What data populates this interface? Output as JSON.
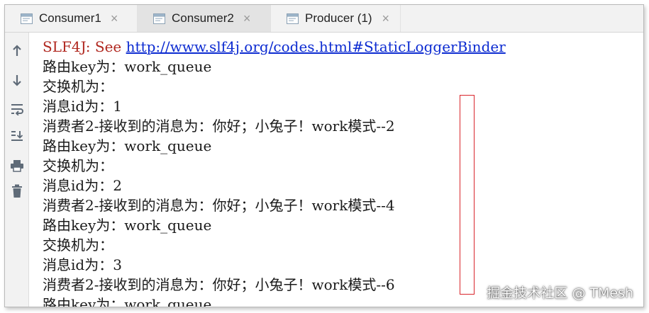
{
  "tabs": [
    {
      "label": "Consumer1",
      "close": "×",
      "active": false
    },
    {
      "label": "Consumer2",
      "close": "×",
      "active": true
    },
    {
      "label": "Producer (1)",
      "close": "×",
      "active": false
    }
  ],
  "sidebar": {
    "icons": [
      "arrow-up-icon",
      "arrow-down-icon",
      "soft-wrap-icon",
      "scroll-to-end-icon",
      "print-icon",
      "trash-icon"
    ]
  },
  "console": {
    "first_line": {
      "prefix": "SLF4J: See ",
      "link": "http://www.slf4j.org/codes.html#StaticLoggerBinder"
    },
    "lines": [
      "路由key为：work_queue",
      "交换机为：",
      "消息id为：1",
      "消费者2-接收到的消息为：你好；小兔子！work模式--2",
      "路由key为：work_queue",
      "交换机为：",
      "消息id为：2",
      "消费者2-接收到的消息为：你好；小兔子！work模式--4",
      "路由key为：work_queue",
      "交换机为：",
      "消息id为：3",
      "消费者2-接收到的消息为：你好；小兔子！work模式--6",
      "路由key为：work_queue"
    ]
  },
  "watermark": "掘金技术社区 @ TMesh",
  "colors": {
    "error_text": "#b0271f",
    "link": "#0c2bd1",
    "highlight_box": "#d9262c"
  }
}
